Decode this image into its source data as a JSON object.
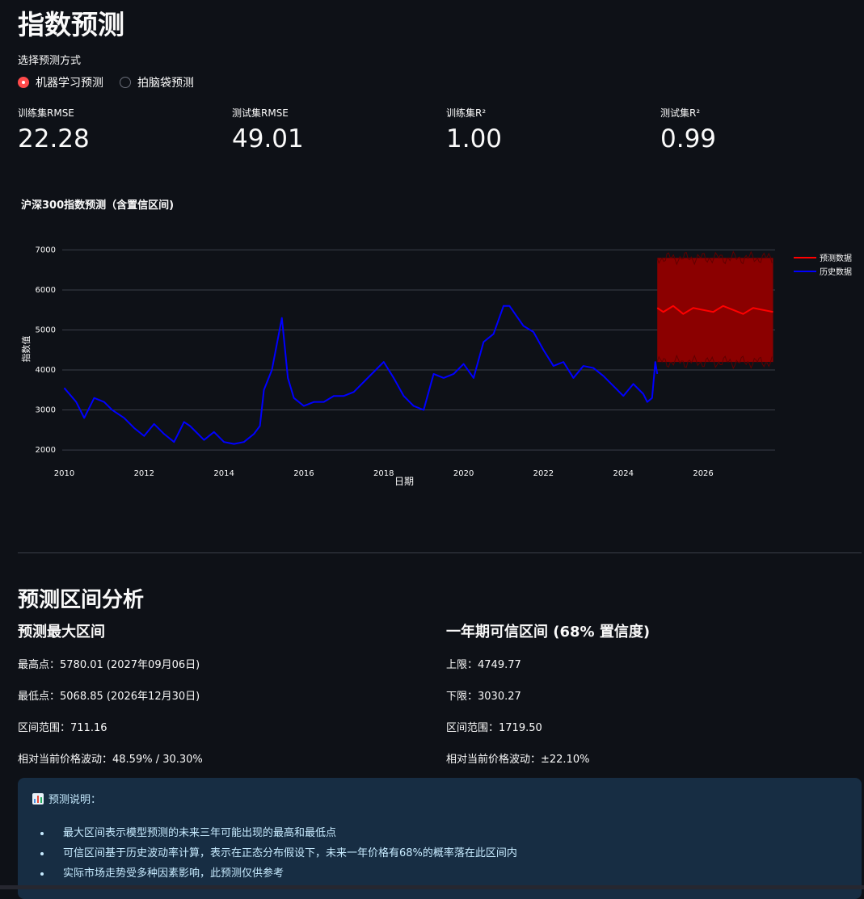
{
  "page": {
    "title": "指数预测"
  },
  "method": {
    "label": "选择预测方式",
    "options": [
      {
        "label": "机器学习预测",
        "selected": true
      },
      {
        "label": "拍脑袋预测",
        "selected": false
      }
    ]
  },
  "metrics": [
    {
      "label": "训练集RMSE",
      "value": "22.28"
    },
    {
      "label": "测试集RMSE",
      "value": "49.01"
    },
    {
      "label": "训练集R²",
      "value": "1.00"
    },
    {
      "label": "测试集R²",
      "value": "0.99"
    }
  ],
  "chart_data": {
    "type": "line",
    "title": "沪深300指数预测（含置信区间)",
    "xlabel": "日期",
    "ylabel": "指数值",
    "xlim": [
      2009.95,
      2027.8
    ],
    "ylim": [
      1800,
      7150
    ],
    "xticks": [
      2010,
      2012,
      2014,
      2016,
      2018,
      2020,
      2022,
      2024,
      2026
    ],
    "yticks": [
      2000,
      3000,
      4000,
      5000,
      6000,
      7000
    ],
    "grid": "horizontal",
    "legend": "top-right",
    "series": [
      {
        "name": "预测数据",
        "color": "#ff0000",
        "x": [
          2024.85,
          2025.0,
          2025.25,
          2025.5,
          2025.75,
          2026.0,
          2026.25,
          2026.5,
          2026.75,
          2027.0,
          2027.25,
          2027.5,
          2027.75
        ],
        "y": [
          5550,
          5450,
          5600,
          5400,
          5550,
          5500,
          5450,
          5600,
          5500,
          5400,
          5550,
          5500,
          5450
        ],
        "band": {
          "upper": 6800,
          "lower": 4200,
          "fill": "#8b0000"
        }
      },
      {
        "name": "历史数据",
        "color": "#0000ff",
        "x": [
          2010.0,
          2010.3,
          2010.5,
          2010.75,
          2011.0,
          2011.2,
          2011.5,
          2011.75,
          2012.0,
          2012.25,
          2012.5,
          2012.75,
          2013.0,
          2013.15,
          2013.5,
          2013.75,
          2014.0,
          2014.25,
          2014.5,
          2014.75,
          2014.9,
          2015.0,
          2015.2,
          2015.45,
          2015.6,
          2015.75,
          2016.0,
          2016.25,
          2016.5,
          2016.75,
          2017.0,
          2017.25,
          2017.5,
          2017.75,
          2018.0,
          2018.25,
          2018.5,
          2018.75,
          2019.0,
          2019.25,
          2019.5,
          2019.75,
          2020.0,
          2020.25,
          2020.5,
          2020.75,
          2021.0,
          2021.15,
          2021.5,
          2021.75,
          2022.0,
          2022.25,
          2022.5,
          2022.75,
          2023.0,
          2023.25,
          2023.5,
          2023.75,
          2024.0,
          2024.25,
          2024.5,
          2024.6,
          2024.72,
          2024.8,
          2024.85
        ],
        "y": [
          3550,
          3200,
          2800,
          3300,
          3200,
          3000,
          2800,
          2550,
          2350,
          2650,
          2400,
          2200,
          2700,
          2600,
          2250,
          2450,
          2200,
          2150,
          2200,
          2400,
          2600,
          3500,
          4000,
          5300,
          3800,
          3300,
          3100,
          3200,
          3200,
          3350,
          3350,
          3450,
          3700,
          3950,
          4200,
          3800,
          3350,
          3100,
          3000,
          3900,
          3800,
          3900,
          4150,
          3800,
          4700,
          4900,
          5600,
          5600,
          5100,
          4950,
          4500,
          4100,
          4200,
          3800,
          4100,
          4050,
          3850,
          3600,
          3350,
          3650,
          3400,
          3200,
          3300,
          4200,
          3900
        ]
      }
    ]
  },
  "analysis": {
    "title": "预测区间分析",
    "max_range": {
      "title": "预测最大区间",
      "rows": [
        "最高点：5780.01 (2027年09月06日)",
        "最低点：5068.85 (2026年12月30日)",
        "区间范围：711.16",
        "相对当前价格波动：48.59% / 30.30%"
      ]
    },
    "confidence": {
      "title": "一年期可信区间 (68% 置信度)",
      "rows": [
        "上限：4749.77",
        "下限：3030.27",
        "区间范围：1719.50",
        "相对当前价格波动：±22.10%"
      ]
    }
  },
  "info": {
    "title": "预测说明：",
    "icon": "bar-chart-icon",
    "items": [
      "最大区间表示模型预测的未来三年可能出现的最高和最低点",
      "可信区间基于历史波动率计算，表示在正态分布假设下，未来一年价格有68%的概率落在此区间内",
      "实际市场走势受多种因素影响，此预测仅供参考"
    ]
  }
}
